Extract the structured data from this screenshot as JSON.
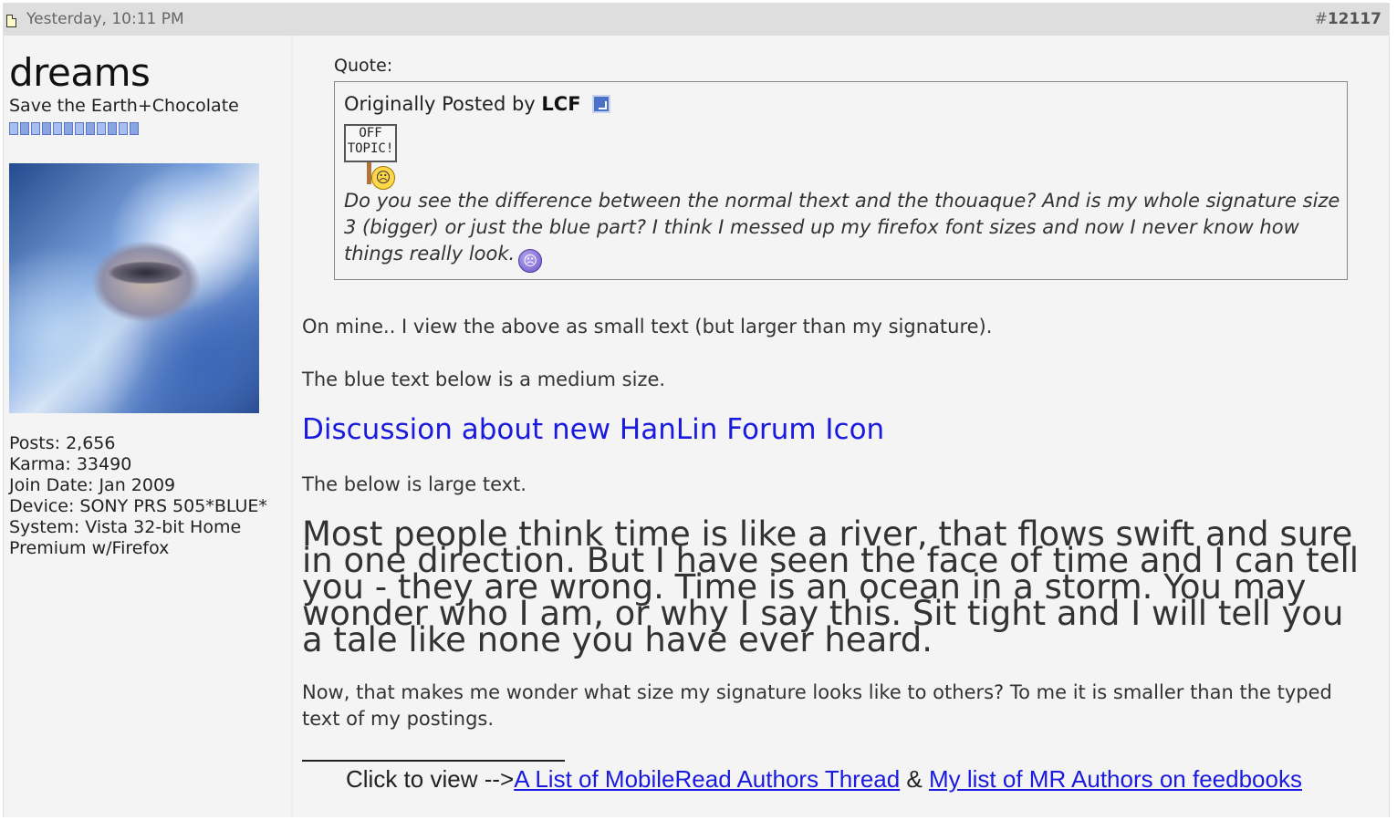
{
  "header": {
    "date": "Yesterday, 10:11 PM",
    "post_number_prefix": "#",
    "post_number": "12117"
  },
  "user": {
    "name": "dreams",
    "title": "Save the Earth+Chocolate",
    "reputation_pips": 12,
    "stats": [
      "Posts: 2,656",
      "Karma: 33490",
      "Join Date: Jan 2009",
      "Device: SONY PRS 505*BLUE*",
      "System: Vista 32-bit Home",
      "Premium w/Firefox"
    ]
  },
  "quote": {
    "label": "Quote:",
    "originally_posted_by": "Originally Posted by",
    "author": "LCF",
    "sign_line1": "OFF",
    "sign_line2": "TOPIC!",
    "text": "Do you see the difference between the normal thext and the thouaque? And is my whole signature size 3 (bigger) or just the blue part? I think I messed up my firefox font sizes and now I never know how things really look."
  },
  "body": {
    "p1": "On mine.. I view the above as small text (but larger than my signature).",
    "p2": "The blue text below is a medium size.",
    "medium_blue": "Discussion about new HanLin Forum Icon",
    "p3": "The below is large text.",
    "large": "Most people think time is like a river, that flows swift and sure in one direction. But I have seen the face of time and I can tell you - they are wrong. Time is an ocean in a storm. You may wonder who I am, or why I say this. Sit tight and I will tell you a tale like none you have ever heard.",
    "p4": "Now, that makes me wonder what size my signature looks like to others? To me it is smaller than the typed text of my postings."
  },
  "signature": {
    "prefix": "Click to view -->",
    "link1": "A List of MobileRead Authors Thread",
    "separator": " & ",
    "link2": "My list of MR Authors on feedbooks"
  }
}
